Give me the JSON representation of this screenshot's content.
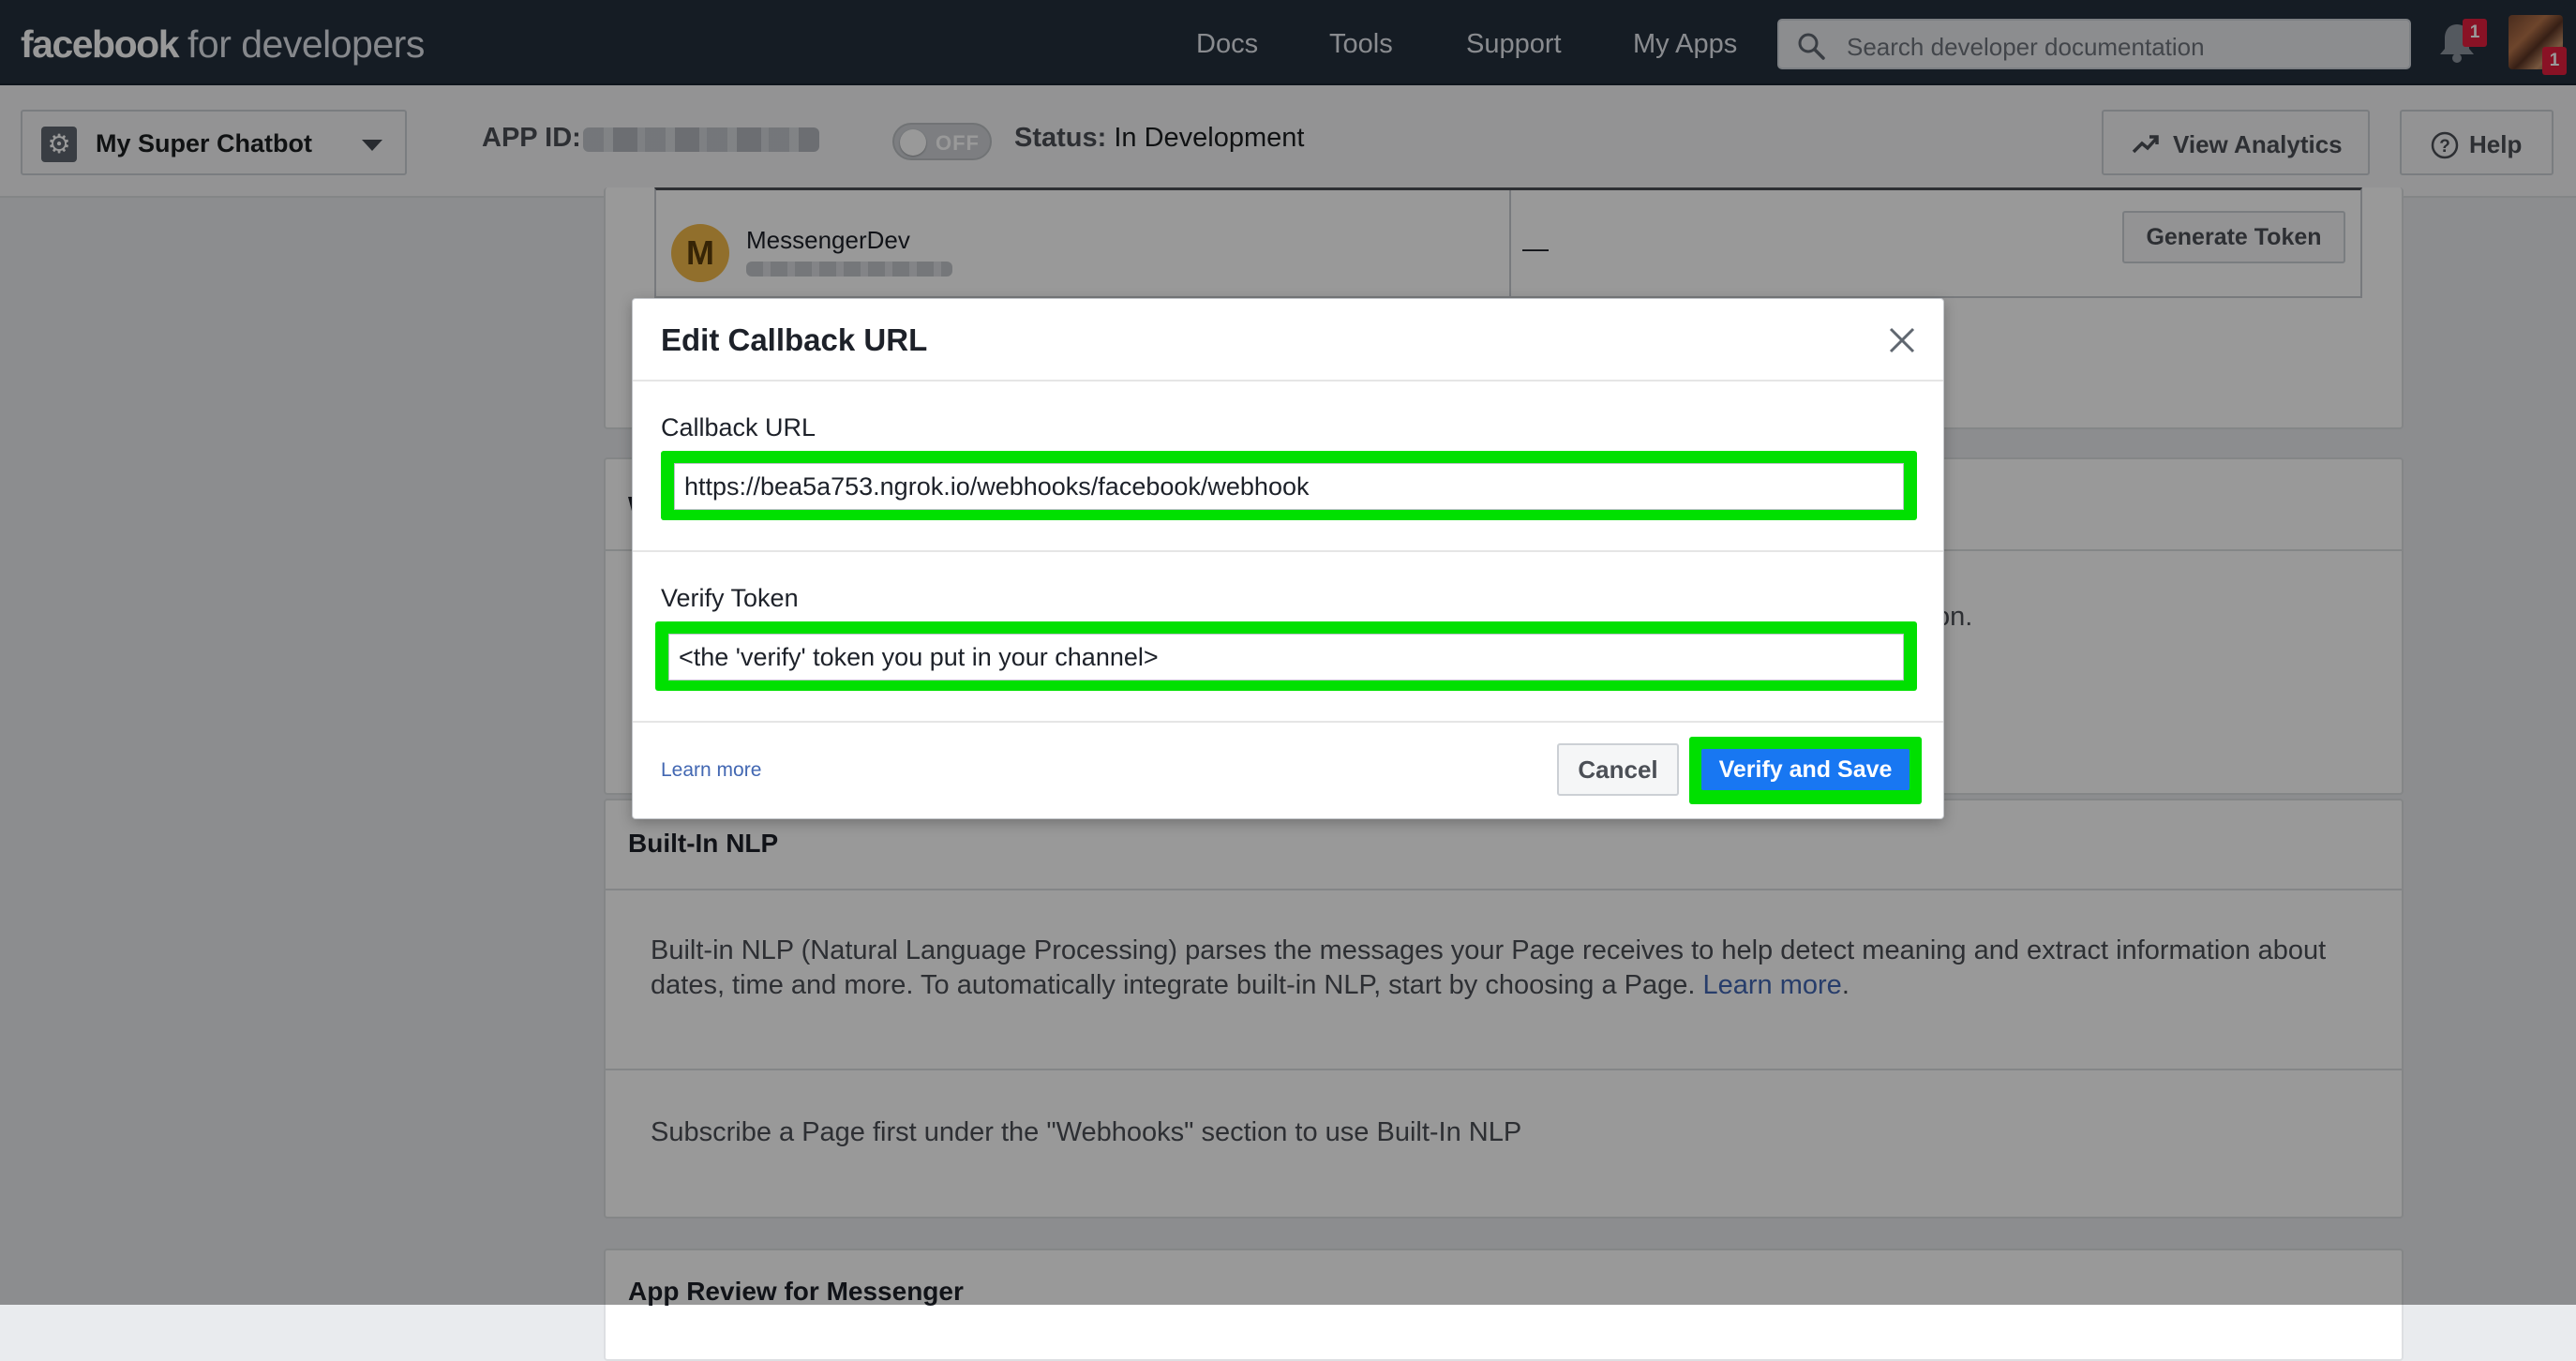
{
  "topbar": {
    "brand_bold": "facebook",
    "brand_rest": "for developers",
    "nav": [
      "Docs",
      "Tools",
      "Support",
      "My Apps"
    ],
    "search_placeholder": "Search developer documentation",
    "notification_count": "1",
    "avatar_badge": "1"
  },
  "subbar": {
    "app_name": "My Super Chatbot",
    "app_id_label": "APP ID:",
    "toggle_label": "OFF",
    "status_label": "Status:",
    "status_value": "In Development",
    "view_analytics": "View Analytics",
    "help": "Help"
  },
  "token_table": {
    "page_initial": "M",
    "page_name": "MessengerDev",
    "token_value": "—",
    "generate_button": "Generate Token"
  },
  "webhooks_card": {
    "heading_partial": "W",
    "text_partial": "on."
  },
  "nlp_card": {
    "heading": "Built-In NLP",
    "description": "Built-in NLP (Natural Language Processing) parses the messages your Page receives to help detect meaning and extract information about dates, time and more. To automatically integrate built-in NLP, start by choosing a Page.",
    "learn_more": "Learn more",
    "learn_more_suffix": ".",
    "subscribe_note": "Subscribe a Page first under the \"Webhooks\" section to use Built-In NLP"
  },
  "review_card": {
    "heading": "App Review for Messenger"
  },
  "modal": {
    "title": "Edit Callback URL",
    "callback_label": "Callback URL",
    "callback_value": "https://bea5a753.ngrok.io/webhooks/facebook/webhook",
    "verify_label": "Verify Token",
    "verify_value": "<the 'verify' token you put in your channel>",
    "learn_more": "Learn more",
    "cancel": "Cancel",
    "verify_save": "Verify and Save",
    "highlight_color": "#00e000"
  },
  "icons": [
    "search-icon",
    "bell-icon",
    "gear-icon",
    "chevron-down-icon",
    "trend-up-icon",
    "help-icon",
    "close-icon"
  ]
}
